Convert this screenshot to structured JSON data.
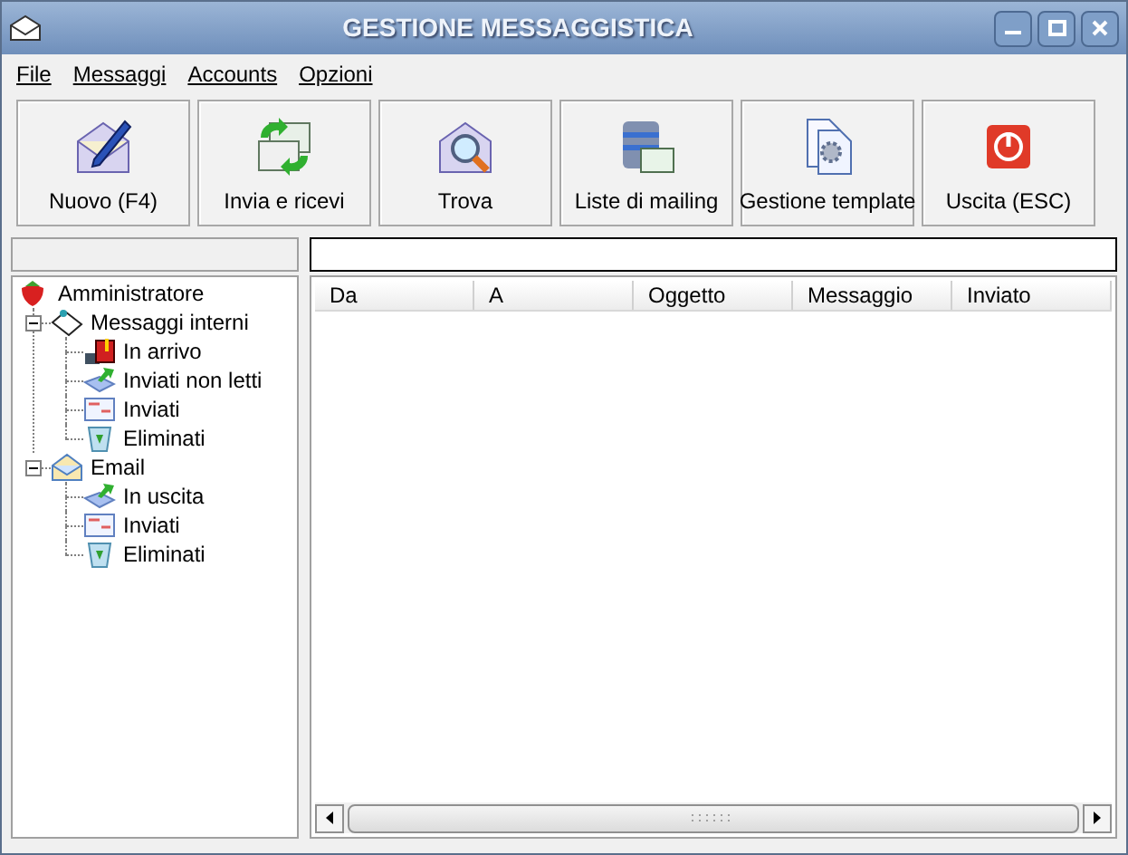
{
  "window": {
    "title": "GESTIONE MESSAGGISTICA"
  },
  "menu": [
    "File",
    "Messaggi",
    "Accounts",
    "Opzioni"
  ],
  "toolbar": [
    {
      "label": "Nuovo (F4)",
      "kind": "new"
    },
    {
      "label": "Invia e ricevi",
      "kind": "sync"
    },
    {
      "label": "Trova",
      "kind": "find"
    },
    {
      "label": "Liste di mailing",
      "kind": "lists"
    },
    {
      "label": "Gestione template",
      "kind": "template"
    },
    {
      "label": "Uscita (ESC)",
      "kind": "exit"
    }
  ],
  "tree": {
    "label": "Amministratore",
    "kind": "root",
    "children": [
      {
        "label": "Messaggi interni",
        "kind": "internal",
        "expanded": true,
        "children": [
          {
            "label": "In arrivo",
            "kind": "inbox"
          },
          {
            "label": "Inviati non letti",
            "kind": "outbox"
          },
          {
            "label": "Inviati",
            "kind": "sent"
          },
          {
            "label": "Eliminati",
            "kind": "trash"
          }
        ]
      },
      {
        "label": "Email",
        "kind": "email",
        "expanded": true,
        "children": [
          {
            "label": "In uscita",
            "kind": "outbox"
          },
          {
            "label": "Inviati",
            "kind": "sent"
          },
          {
            "label": "Eliminati",
            "kind": "trash"
          }
        ]
      }
    ]
  },
  "table": {
    "columns": [
      "Da",
      "A",
      "Oggetto",
      "Messaggio",
      "Inviato"
    ]
  }
}
